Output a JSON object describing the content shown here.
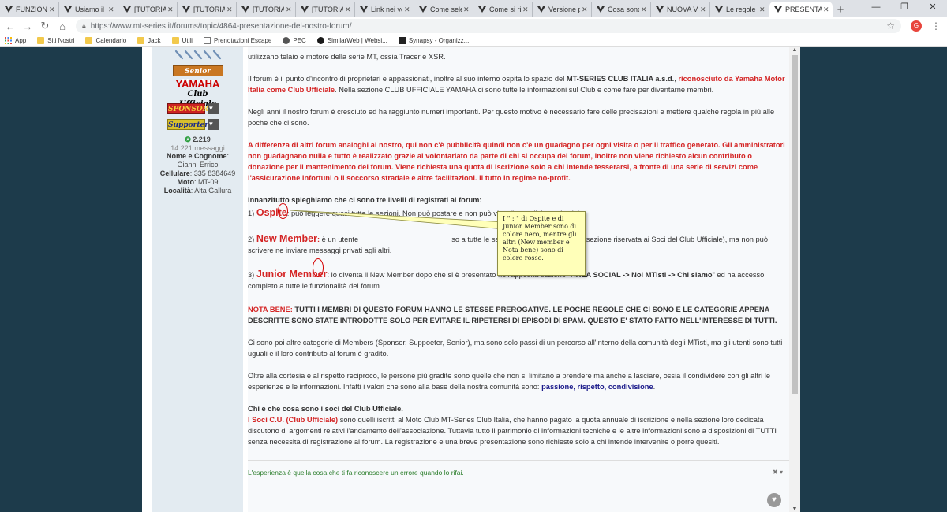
{
  "tabs": [
    {
      "label": "FUNZIONALITÀ"
    },
    {
      "label": "Usiamo il"
    },
    {
      "label": "[TUTORIAL]"
    },
    {
      "label": "[TUTORIAL]"
    },
    {
      "label": "[TUTORIAL]"
    },
    {
      "label": "[TUTORIAL]"
    },
    {
      "label": "Link nei vo"
    },
    {
      "label": "Come sele"
    },
    {
      "label": "Come si ri"
    },
    {
      "label": "Versione p"
    },
    {
      "label": "Cosa sono"
    },
    {
      "label": "NUOVA VE"
    },
    {
      "label": "Le regole"
    },
    {
      "label": "PRESENTA"
    }
  ],
  "toolbar": {
    "url": "https://www.mt-series.it/forums/topic/4864-presentazione-del-nostro-forum/",
    "profile_initial": "G"
  },
  "bookmarks": [
    {
      "label": "App",
      "icon": "apps-grid-icon"
    },
    {
      "label": "Siti Nostri",
      "icon": "folder-icon"
    },
    {
      "label": "Calendario",
      "icon": "folder-icon"
    },
    {
      "label": "Jack",
      "icon": "folder-icon"
    },
    {
      "label": "Utili",
      "icon": "folder-icon"
    },
    {
      "label": "Prenotazioni Escape",
      "icon": "page-icon"
    },
    {
      "label": "PEC",
      "icon": "page-icon"
    },
    {
      "label": "SimilarWeb | Websi...",
      "icon": "similarweb-icon"
    },
    {
      "label": "Synapsy - Organizz...",
      "icon": "synapsy-icon"
    }
  ],
  "user": {
    "badges": {
      "senior": "Senior Member",
      "yamaha": "YAMAHA",
      "club": "Club Ufficiale",
      "sponsor": "SPONSOR",
      "supporter": "Supporter"
    },
    "reputation": "2.219",
    "messages": "14.221 messaggi",
    "name_label": "Nome e Cognome",
    "name_value": ": Gianni Errico",
    "phone_label": "Cellulare",
    "phone_value": ": 335 8384649",
    "moto_label": "Moto",
    "moto_value": ": MT-09",
    "loc_label": "Località",
    "loc_value": ": Alta Gallura"
  },
  "post": {
    "p0": "utilizzano telaio e motore della serie MT, ossia Tracer e XSR.",
    "p1a": "Il forum è il punto d'incontro di proprietari e appassionati, inoltre al suo interno ospita lo spazio del ",
    "p1b": "MT-SERIES CLUB ITALIA a.s.d.",
    "p1c": ", ",
    "p1d": "riconosciuto da Yamaha Motor Italia come Club Ufficiale",
    "p1e": ". Nella sezione CLUB UFFICIALE YAMAHA ci sono tutte le informazioni sul Club e come fare per diventarne membri.",
    "p2": "Negli anni il nostro forum è cresciuto ed ha raggiunto numeri importanti. Per questo motivo è necessario fare delle precisazioni e mettere qualche regola in più alle poche che ci sono.",
    "p3": "A differenza di altri forum analoghi al nostro, qui non c'è pubblicità quindi non c'è un guadagno per ogni visita o per il traffico generato. Gli amministratori non guadagnano nulla e tutto è realizzato grazie al volontariato da parte di chi si occupa del forum, inoltre non viene richiesto alcun contributo o donazione per il mantenimento del forum. Viene richiesta una quota di iscrizione solo a chi intende tesserarsi, a fronte di una serie di servizi come l'assicurazione infortuni o il soccorso stradale e altre facilitazioni. Il tutto in regime no-profit.",
    "levels_intro": "Innanzitutto spieghiamo che ci sono tre livelli di registrati al forum:",
    "l1_num": "1) ",
    "l1_name": "Ospite",
    "l1_colon": ":",
    "l1_text": " può leggere quasi tutte le sezioni. Non può postare e non può visualizzare l'elenco iscritti.",
    "l2_num": "2) ",
    "l2_name": "New Member",
    "l2_colon": ":",
    "l2_text_a": " è un utente",
    "l2_text_b": "so a tutte le sezioni del forum (esclusa la sezione riservata ai Soci del Club Ufficiale), ma non può scrivere ne inviare messaggi privati agli altri.",
    "l3_num": "3) ",
    "l3_name": "Junior Member",
    "l3_colon": ":",
    "l3_text_a": " lo diventa il New Member dopo che si è presentato nell'apposita sezione \"",
    "l3_text_b": "AREA SOCIAL -> Noi MTisti -> Chi siamo",
    "l3_text_c": "\" ed ha accesso completo a tutte le funzionalità del forum.",
    "nb_label": "NOTA BENE:",
    "nb_text": " TUTTI I MEMBRI DI QUESTO FORUM HANNO LE STESSE PREROGATIVE. LE POCHE REGOLE CHE CI SONO E LE CATEGORIE APPENA DESCRITTE SONO STATE INTRODOTTE SOLO PER EVITARE IL RIPETERSI DI EPISODI DI SPAM. QUESTO E' STATO FATTO NELL'INTERESSE DI TUTTI.",
    "p5": "Ci sono poi altre categorie di Members (Sponsor, Suppoeter, Senior), ma sono solo passi di un percorso all'interno della comunità degli MTisti, ma gli utenti sono tutti uguali e il loro contributo al forum è gradito.",
    "p6a": "Oltre alla cortesia e al rispetto reciproco, le persone più gradite sono quelle che non si limitano a prendere ma anche a lasciare, ossia il condividere con gli altri le esperienze e le informazioni. Infatti i valori che sono alla base della nostra comunità sono: ",
    "p6b": "passione, rispetto, condivisione",
    "p6c": ".",
    "h_club": "Chi e che cosa sono i soci del Club Ufficiale.",
    "club_a": "I Soci C.U. (Club Ufficiale)",
    "club_b": " sono quelli iscritti al Moto Club MT-Series Club Italia, che hanno pagato la quota annuale di iscrizione e nella sezione loro dedicata discutono di argomenti relativi l'andamento dell'associazione. Tuttavia tutto il patrimonio di informazioni tecniche e le altre informazioni sono a disposizioni di TUTTI senza necessità di registrazione al forum. La registrazione e una breve presentazione sono richieste solo a chi intende intervenire o porre quesiti.",
    "signature": "L'esperienza è quella cosa che ti fa riconoscere un errore quando lo rifai."
  },
  "callout": {
    "text": "I \" : \" di Ospite e di Junior Member sono di colore nero, mentre gli altri (New member e Nota bene) sono di colore rosso."
  },
  "colors": {
    "page_bg": "#1d3b4b",
    "accent_red": "#d42525",
    "link_navy": "#1a1a8a",
    "signature_green": "#2a7d2a",
    "callout_bg": "#ffffb9"
  }
}
